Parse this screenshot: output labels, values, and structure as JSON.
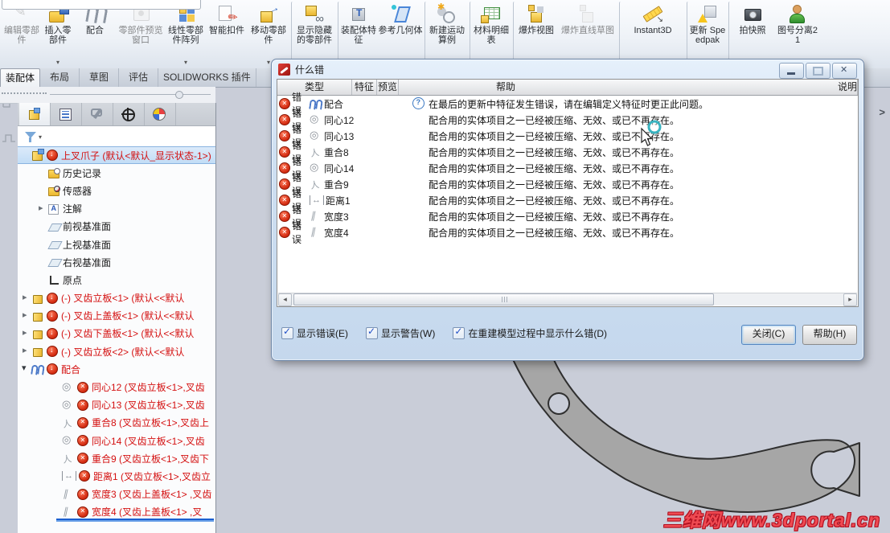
{
  "toolbar": {
    "items": [
      {
        "label": "编辑零部件",
        "icon": "edit-component",
        "cls": "disabled"
      },
      {
        "label": "插入零部件",
        "icon": "insert-component",
        "caret": "▾"
      },
      {
        "label": "配合",
        "icon": "mate"
      },
      {
        "label": "零部件预览窗口",
        "icon": "component-preview",
        "cls": "disabled"
      },
      {
        "label": "线性零部件阵列",
        "icon": "linear-component-pattern",
        "caret": "▾"
      },
      {
        "label": "智能扣件",
        "icon": "smart-fasteners"
      },
      {
        "label": "移动零部件",
        "icon": "move-component",
        "caret": "▾"
      },
      {
        "label": "显示隐藏的零部件",
        "icon": "show-hidden-components",
        "cls": "sep"
      },
      {
        "label": "装配体特征",
        "icon": "assembly-features",
        "cls": "sep"
      },
      {
        "label": "参考几何体",
        "icon": "reference-geometry"
      },
      {
        "label": "新建运动算例",
        "icon": "new-motion-study",
        "cls": "sep"
      },
      {
        "label": "材料明细表",
        "icon": "bill-of-materials",
        "cls": "sep"
      },
      {
        "label": "爆炸视图",
        "icon": "exploded-view",
        "cls": "sep"
      },
      {
        "label": "爆炸直线草图",
        "icon": "explode-line-sketch",
        "cls": "disabled"
      },
      {
        "label": "Instant3D",
        "icon": "instant3d",
        "cls": "sep"
      },
      {
        "label": "更新 Speedpak",
        "icon": "update-speedpak",
        "cls": "sep"
      },
      {
        "label": "拍快照",
        "icon": "take-snapshot",
        "cls": "sep"
      },
      {
        "label": "图号分离21",
        "icon": "drawing-number-split"
      }
    ]
  },
  "command_tabs": {
    "items": [
      {
        "label": "装配体",
        "cls": "active"
      },
      {
        "label": "布局"
      },
      {
        "label": "草图"
      },
      {
        "label": "评估"
      },
      {
        "label": "SOLIDWORKS 插件"
      }
    ]
  },
  "left_panel": {
    "tabs": [
      {
        "icon": "featuremanager-tree",
        "cls": "active"
      },
      {
        "icon": "display-pane-list"
      },
      {
        "icon": "propertymanager"
      },
      {
        "icon": "configurationmanager"
      },
      {
        "icon": "displaymanager"
      }
    ],
    "tree": [
      {
        "indent": 0,
        "icon": "assembly",
        "badge": "arrow",
        "label": "上叉爪子 (默认<默认_显示状态-1>)",
        "cls": "sel red"
      },
      {
        "indent": 1,
        "icon": "history",
        "label": "历史记录"
      },
      {
        "indent": 1,
        "icon": "sensors",
        "label": "传感器"
      },
      {
        "indent": 1,
        "arrow": "right",
        "icon": "annotations",
        "label": "注解"
      },
      {
        "indent": 1,
        "icon": "plane",
        "label": "前视基准面"
      },
      {
        "indent": 1,
        "icon": "plane",
        "label": "上视基准面"
      },
      {
        "indent": 1,
        "icon": "plane",
        "label": "右视基准面"
      },
      {
        "indent": 1,
        "icon": "origin",
        "label": "原点"
      },
      {
        "indent": 0,
        "arrow": "right",
        "icon": "part",
        "badge": "arrow",
        "label": "(-) 叉齿立板<1> (默认<<默认",
        "cls": "red"
      },
      {
        "indent": 0,
        "arrow": "right",
        "icon": "part",
        "badge": "arrow",
        "label": "(-) 叉齿上盖板<1> (默认<<默认",
        "cls": "red"
      },
      {
        "indent": 0,
        "arrow": "right",
        "icon": "part",
        "badge": "arrow",
        "label": "(-) 叉齿下盖板<1> (默认<<默认",
        "cls": "red"
      },
      {
        "indent": 0,
        "arrow": "right",
        "icon": "part",
        "badge": "arrow",
        "label": "(-) 叉齿立板<2> (默认<<默认",
        "cls": "red"
      },
      {
        "indent": 0,
        "arrow": "down",
        "icon": "paperclip",
        "badge": "arrow",
        "label": "配合",
        "cls": "red"
      },
      {
        "indent": 2,
        "icon": "concentric",
        "badge": "x",
        "label": "同心12 (叉齿立板<1>,叉齿",
        "cls": "red"
      },
      {
        "indent": 2,
        "icon": "concentric",
        "badge": "x",
        "label": "同心13 (叉齿立板<1>,叉齿",
        "cls": "red"
      },
      {
        "indent": 2,
        "icon": "coincident",
        "badge": "x",
        "label": "重合8 (叉齿立板<1>,叉齿上",
        "cls": "red"
      },
      {
        "indent": 2,
        "icon": "concentric",
        "badge": "x",
        "label": "同心14 (叉齿立板<1>,叉齿",
        "cls": "red"
      },
      {
        "indent": 2,
        "icon": "coincident",
        "badge": "x",
        "label": "重合9 (叉齿立板<1>,叉齿下",
        "cls": "red"
      },
      {
        "indent": 2,
        "icon": "distance",
        "badge": "x",
        "label": "距离1 (叉齿立板<1>,叉齿立",
        "cls": "red"
      },
      {
        "indent": 2,
        "icon": "width",
        "badge": "x",
        "label": "宽度3 (叉齿上盖板<1> ,叉齿",
        "cls": "red"
      },
      {
        "indent": 2,
        "icon": "width",
        "badge": "x",
        "label": "宽度4 (叉齿上盖板<1> ,叉",
        "cls": "red"
      }
    ]
  },
  "dialog": {
    "title": "什么错",
    "window_buttons": [
      {
        "icon": "minimize"
      },
      {
        "icon": "maximize"
      },
      {
        "icon": "close"
      }
    ],
    "columns": [
      {
        "label": "类型"
      },
      {
        "label": "特征"
      },
      {
        "label": "预览"
      },
      {
        "label": "帮助"
      },
      {
        "label": "说明"
      }
    ],
    "rows": [
      {
        "type": "错误",
        "icon": "paperclip",
        "feature": "配合",
        "cls": "hh",
        "desc": "在最后的更新中特征发生错误，请在编辑定义特征时更正此问题。"
      },
      {
        "type": "错误",
        "icon": "concentric",
        "feature": "同心12",
        "desc": "配合用的实体项目之一已经被压缩、无效、或已不再存在。"
      },
      {
        "type": "错误",
        "icon": "concentric",
        "feature": "同心13",
        "desc": "配合用的实体项目之一已经被压缩、无效、或已不再存在。"
      },
      {
        "type": "错误",
        "icon": "coincident",
        "feature": "重合8",
        "desc": "配合用的实体项目之一已经被压缩、无效、或已不再存在。"
      },
      {
        "type": "错误",
        "icon": "concentric",
        "feature": "同心14",
        "desc": "配合用的实体项目之一已经被压缩、无效、或已不再存在。"
      },
      {
        "type": "错误",
        "icon": "coincident",
        "feature": "重合9",
        "desc": "配合用的实体项目之一已经被压缩、无效、或已不再存在。"
      },
      {
        "type": "错误",
        "icon": "distance",
        "feature": "距离1",
        "desc": "配合用的实体项目之一已经被压缩、无效、或已不再存在。"
      },
      {
        "type": "错误",
        "icon": "width",
        "feature": "宽度3",
        "desc": "配合用的实体项目之一已经被压缩、无效、或已不再存在。"
      },
      {
        "type": "错误",
        "icon": "width",
        "feature": "宽度4",
        "desc": "配合用的实体项目之一已经被压缩、无效、或已不再存在。"
      }
    ],
    "checkboxes": [
      {
        "label": "显示错误(E)",
        "checked": "true"
      },
      {
        "label": "显示警告(W)",
        "checked": "true"
      },
      {
        "label": "在重建模型过程中显示什么错(D)",
        "checked": "true"
      }
    ],
    "buttons": [
      {
        "label": "关闭(C)",
        "cls": "default"
      },
      {
        "label": "帮助(H)"
      }
    ]
  },
  "viewport": {
    "watermark": "三维网www.3dportal.cn"
  }
}
